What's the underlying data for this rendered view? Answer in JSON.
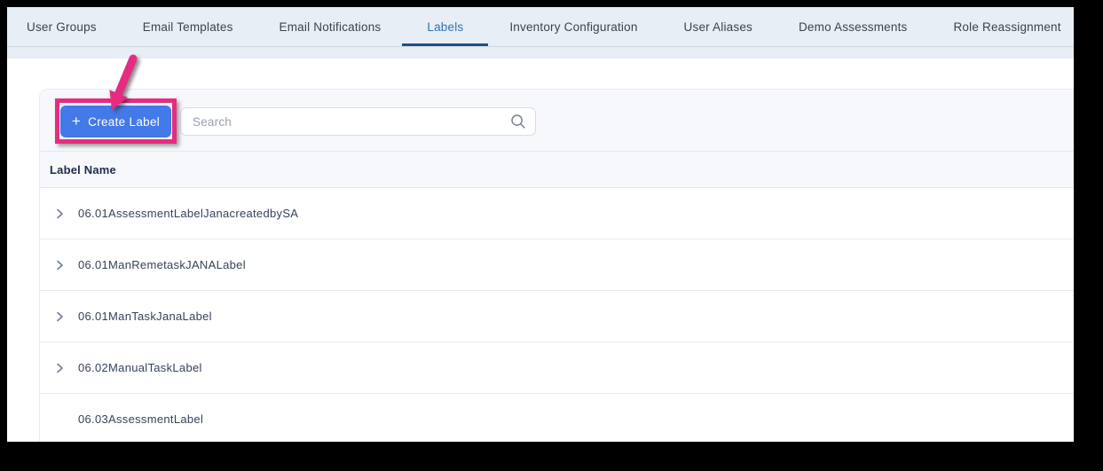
{
  "tab_bar": {
    "tabs": [
      {
        "label": "User Groups",
        "active": false
      },
      {
        "label": "Email Templates",
        "active": false
      },
      {
        "label": "Email Notifications",
        "active": false
      },
      {
        "label": "Labels",
        "active": true
      },
      {
        "label": "Inventory Configuration",
        "active": false
      },
      {
        "label": "User Aliases",
        "active": false
      },
      {
        "label": "Demo Assessments",
        "active": false
      },
      {
        "label": "Role Reassignment",
        "active": false
      }
    ]
  },
  "toolbar": {
    "create_button": {
      "plus_icon": "+",
      "label": "Create Label"
    },
    "search": {
      "placeholder": "Search",
      "value": ""
    }
  },
  "table": {
    "header": "Label Name",
    "rows": [
      {
        "name": "06.01AssessmentLabelJanacreatedbySA",
        "expandable": true
      },
      {
        "name": "06.01ManRemetaskJANALabel",
        "expandable": true
      },
      {
        "name": "06.01ManTaskJanaLabel",
        "expandable": true
      },
      {
        "name": "06.02ManualTaskLabel",
        "expandable": true
      },
      {
        "name": "06.03AssessmentLabel",
        "expandable": false
      }
    ]
  },
  "annotation": {
    "highlight_color": "#e62c82"
  },
  "colors": {
    "button_blue": "#4379e8",
    "active_tab_blue": "#2e72b8",
    "tab_underline_navy": "#20507f",
    "tab_bar_bg": "#e8eef5",
    "panel_header_bg": "#f6f8fb",
    "annotation_pink": "#e62c82"
  }
}
